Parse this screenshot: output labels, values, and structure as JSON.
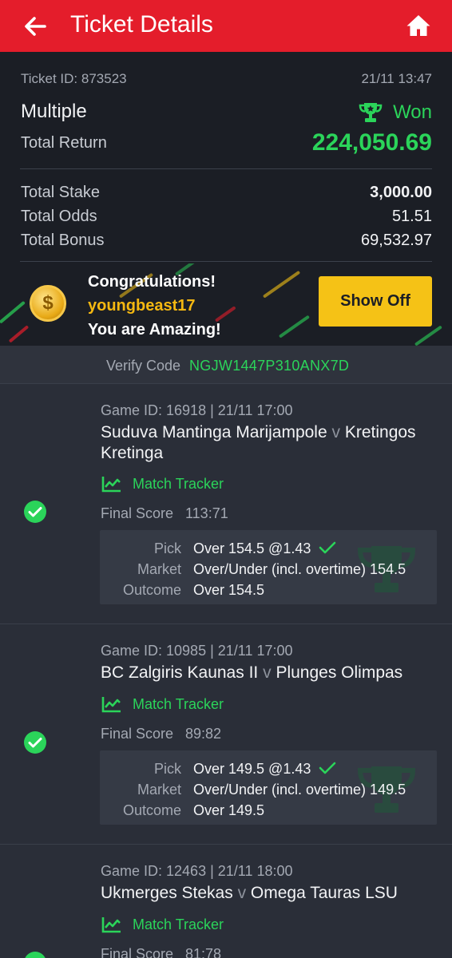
{
  "header": {
    "title": "Ticket Details"
  },
  "ticket": {
    "id": "Ticket ID: 873523",
    "date": "21/11 13:47",
    "bet_type": "Multiple",
    "status": "Won",
    "return_label": "Total Return",
    "return_value": "224,050.69",
    "stake_label": "Total Stake",
    "stake_value": "3,000.00",
    "odds_label": "Total Odds",
    "odds_value": "51.51",
    "bonus_label": "Total Bonus",
    "bonus_value": "69,532.97"
  },
  "banner": {
    "coin_symbol": "$",
    "congrats": "Congratulations!",
    "username": "youngbeast17",
    "message": "You are Amazing!",
    "button": "Show Off"
  },
  "verify": {
    "label": "Verify Code",
    "code": "NGJW1447P310ANX7D"
  },
  "labels": {
    "match_tracker": "Match Tracker",
    "final_score": "Final Score",
    "pick": "Pick",
    "market": "Market",
    "outcome": "Outcome",
    "vs": "v"
  },
  "games": [
    {
      "meta": "Game ID: 16918 | 21/11 17:00",
      "home": "Suduva Mantinga Marijampole",
      "away": "Kretingos Kretinga",
      "score": "113:71",
      "pick": "Over 154.5 @1.43",
      "market": "Over/Under (incl. overtime) 154.5",
      "outcome": "Over 154.5"
    },
    {
      "meta": "Game ID: 10985 | 21/11 17:00",
      "home": "BC Zalgiris Kaunas II",
      "away": "Plunges Olimpas",
      "score": "89:82",
      "pick": "Over 149.5 @1.43",
      "market": "Over/Under (incl. overtime) 149.5",
      "outcome": "Over 149.5"
    },
    {
      "meta": "Game ID: 12463 | 21/11 18:00",
      "home": "Ukmerges Stekas",
      "away": "Omega Tauras LSU",
      "score": "81:78"
    }
  ],
  "colors": {
    "brand_red": "#e41d2b",
    "win_green": "#2bd45a",
    "accent_yellow": "#f5c216"
  }
}
